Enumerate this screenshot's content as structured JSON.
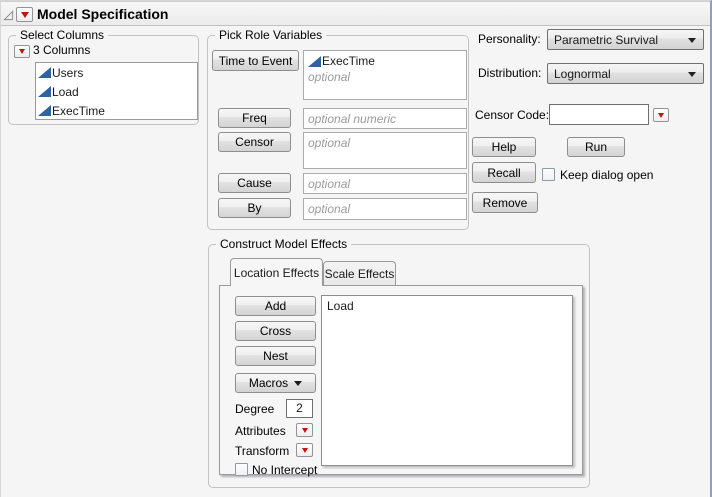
{
  "window": {
    "title": "Model Specification"
  },
  "select_columns": {
    "label": "Select Columns",
    "group_label": "3 Columns",
    "columns": [
      {
        "name": "Users",
        "icon": "continuous-triangle-icon"
      },
      {
        "name": "Load",
        "icon": "continuous-triangle-icon"
      },
      {
        "name": "ExecTime",
        "icon": "continuous-triangle-icon"
      }
    ]
  },
  "pick_roles": {
    "label": "Pick Role Variables",
    "roles": [
      {
        "button": "Time to Event",
        "value": "ExecTime",
        "placeholder": "optional"
      },
      {
        "button": "Freq",
        "value": "",
        "placeholder": "optional numeric"
      },
      {
        "button": "Censor",
        "value": "",
        "placeholder": "optional"
      },
      {
        "button": "Cause",
        "value": "",
        "placeholder": "optional"
      },
      {
        "button": "By",
        "value": "",
        "placeholder": "optional"
      }
    ]
  },
  "options": {
    "personality_label": "Personality:",
    "personality_value": "Parametric Survival",
    "distribution_label": "Distribution:",
    "distribution_value": "Lognormal",
    "censor_code_label": "Censor Code:",
    "censor_code_value": "",
    "help_label": "Help",
    "run_label": "Run",
    "recall_label": "Recall",
    "keep_dialog_open_label": "Keep dialog open",
    "keep_dialog_open_checked": false,
    "remove_label": "Remove"
  },
  "model_effects": {
    "label": "Construct Model Effects",
    "tabs": [
      {
        "label": "Location Effects",
        "active": true
      },
      {
        "label": "Scale Effects",
        "active": false
      }
    ],
    "add_label": "Add",
    "cross_label": "Cross",
    "nest_label": "Nest",
    "macros_label": "Macros",
    "degree_label": "Degree",
    "degree_value": "2",
    "attributes_label": "Attributes",
    "transform_label": "Transform",
    "no_intercept_label": "No Intercept",
    "no_intercept_checked": false,
    "effects": [
      "Load"
    ]
  },
  "colors": {
    "red_triangle": "#c41414",
    "continuous_blue": "#2e62a1",
    "background": "#f5f5f6"
  }
}
